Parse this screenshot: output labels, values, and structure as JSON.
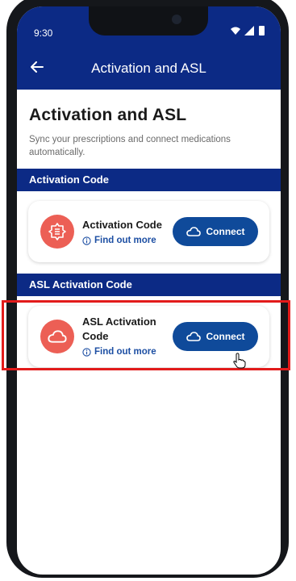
{
  "status_bar": {
    "time": "9:30"
  },
  "header": {
    "title": "Activation and ASL",
    "back_icon": "arrow-left-icon"
  },
  "page": {
    "title": "Activation and ASL",
    "subtitle": "Sync your prescriptions and connect medications automatically."
  },
  "sections": [
    {
      "header": "Activation Code",
      "card": {
        "icon": "activation-badge-icon",
        "title": "Activation Code",
        "link": "Find out more",
        "button": "Connect"
      }
    },
    {
      "header": "ASL Activation Code",
      "card": {
        "icon": "cloud-icon",
        "title": "ASL Activation Code",
        "link": "Find out more",
        "button": "Connect"
      }
    }
  ],
  "colors": {
    "primary": "#0c2a85",
    "button": "#0f4a9a",
    "icon_bg": "#ec5f55",
    "highlight": "#e21b1b"
  }
}
